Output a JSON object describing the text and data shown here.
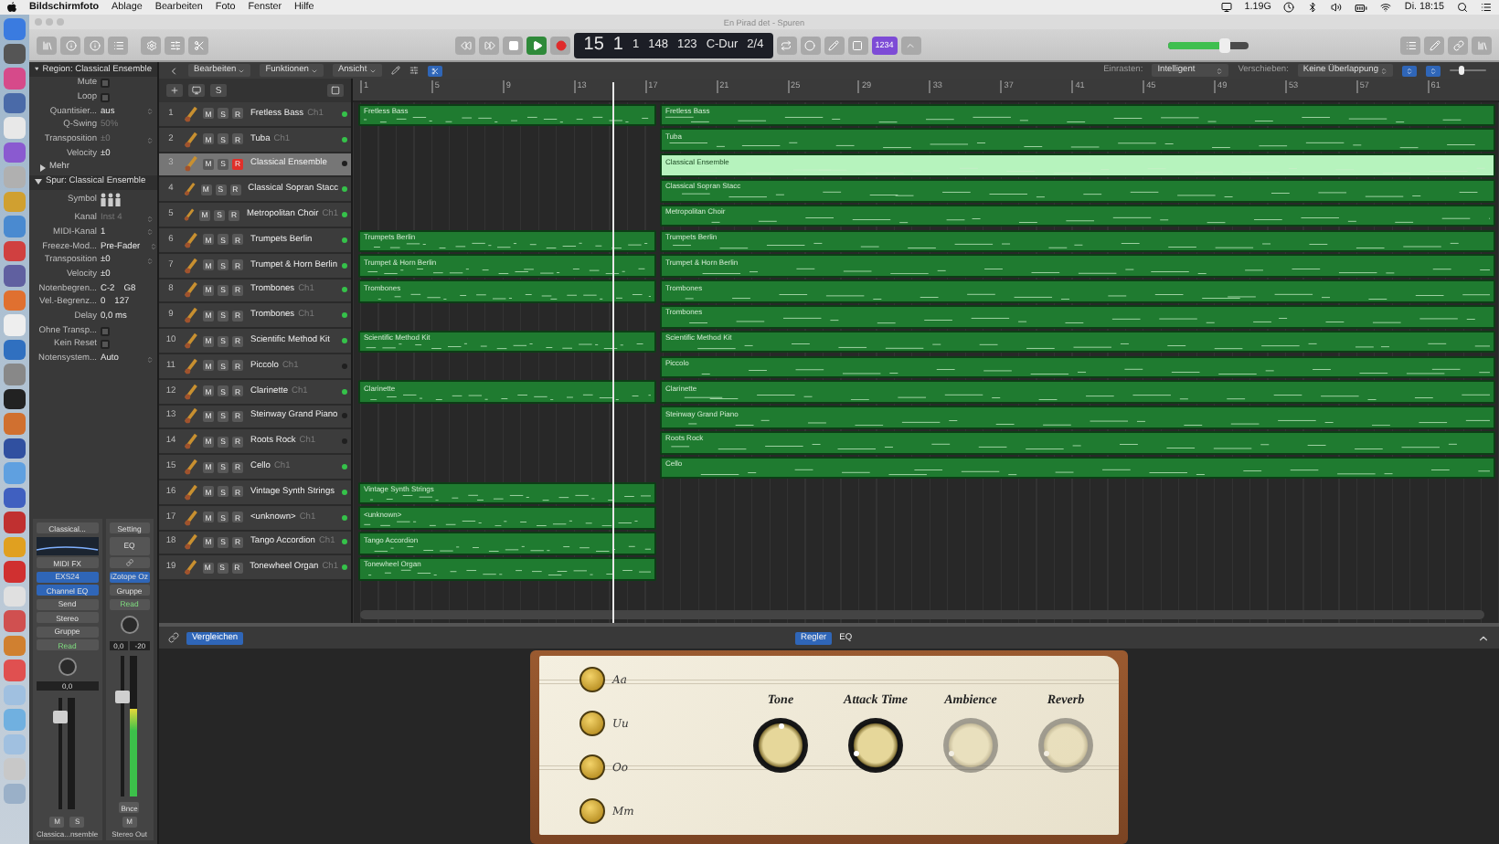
{
  "menu_bar": {
    "app": "Bildschirmfoto",
    "items": [
      "Ablage",
      "Bearbeiten",
      "Foto",
      "Fenster",
      "Hilfe"
    ],
    "memory": "1.19G",
    "clock": "Di. 18:15"
  },
  "window": {
    "title": "En Pirad det - Spuren"
  },
  "transport": {
    "playing": true
  },
  "lcd": [
    "15",
    "1",
    "1",
    "148",
    "123",
    "C-Dur",
    "2/4"
  ],
  "count_in": {
    "label": "1234",
    "on": true
  },
  "master_volume": {
    "level": 0.7
  },
  "arrange_toolbar": {
    "menus": [
      "Bearbeiten",
      "Funktionen",
      "Ansicht"
    ],
    "zoom": {
      "level": 0.3
    },
    "snap_label": "Einrasten:",
    "snap": "Intelligent",
    "drag_label": "Verschieben:",
    "drag": "Keine Überlappung"
  },
  "inspector": {
    "region": {
      "title": "Region: Classical Ensemble",
      "rows": [
        {
          "label": "Mute",
          "kind": "check",
          "checked": false
        },
        {
          "label": "Loop",
          "kind": "check",
          "checked": false
        },
        {
          "label": "Quantisier...",
          "kind": "select",
          "values": [
            "aus"
          ],
          "dim": false
        },
        {
          "label": "Q-Swing",
          "kind": "text",
          "values": [
            "50%"
          ],
          "dim": true
        },
        {
          "label": "Transposition",
          "kind": "select",
          "values": [
            "±0"
          ],
          "dim": true
        },
        {
          "label": "Velocity",
          "kind": "text",
          "values": [
            "±0"
          ],
          "dim": false
        }
      ],
      "more": "Mehr"
    },
    "track": {
      "title": "Spur: Classical Ensemble",
      "rows": [
        {
          "label": "Symbol",
          "kind": "icon"
        },
        {
          "label": "Kanal",
          "kind": "select",
          "values": [
            "Inst 4"
          ],
          "dim": true
        },
        {
          "label": "MIDI-Kanal",
          "kind": "select",
          "values": [
            "1"
          ],
          "dim": false
        },
        {
          "label": "Freeze-Mod...",
          "kind": "select",
          "values": [
            "Pre-Fader"
          ],
          "dim": false
        },
        {
          "label": "Transposition",
          "kind": "select",
          "values": [
            "±0"
          ],
          "dim": false
        },
        {
          "label": "Velocity",
          "kind": "text",
          "values": [
            "±0"
          ],
          "dim": false
        },
        {
          "label": "Notenbegren...",
          "kind": "text",
          "values": [
            "C-2",
            "G8"
          ],
          "dim": false
        },
        {
          "label": "Vel.-Begrenz...",
          "kind": "text",
          "values": [
            "0",
            "127"
          ],
          "dim": false
        },
        {
          "label": "Delay",
          "kind": "text",
          "values": [
            "0,0 ms"
          ],
          "dim": false
        },
        {
          "label": "Ohne Transp...",
          "kind": "check",
          "checked": false
        },
        {
          "label": "Kein Reset",
          "kind": "check",
          "checked": false
        },
        {
          "label": "Notensystem...",
          "kind": "select",
          "values": [
            "Auto"
          ],
          "dim": false
        }
      ]
    }
  },
  "channel_strips": [
    {
      "setting": "Classical...",
      "midi_fx": "MIDI FX",
      "inserts": [
        "EXS24",
        "Channel EQ"
      ],
      "send": "Send",
      "output": "Stereo",
      "group": "Gruppe",
      "automation": "Read",
      "readouts": [
        "0,0"
      ],
      "fader": {
        "level": 0.82
      },
      "meter": {
        "level": 0
      },
      "buttons": [
        "M",
        "S"
      ],
      "name": "Classica...nsemble"
    },
    {
      "setting": "Setting",
      "eq": "EQ",
      "inserts": [
        "iZotope Oz"
      ],
      "group": "Gruppe",
      "automation": "Read",
      "readouts": [
        "0,0",
        "-20"
      ],
      "fader": {
        "level": 0.7
      },
      "meter": {
        "level": 0.62
      },
      "bounce": "Bnce",
      "buttons": [
        "M"
      ],
      "name": "Stereo Out"
    }
  ],
  "track_list_header": {
    "solo": "S"
  },
  "ruler": [
    "1",
    "5",
    "9",
    "13",
    "17",
    "21",
    "25",
    "29",
    "33",
    "37",
    "41",
    "45",
    "49",
    "53",
    "57",
    "61"
  ],
  "playhead": {
    "level": 0.227
  },
  "tracks": [
    {
      "number": "1",
      "name": "Fretless Bass",
      "channel": "Ch1",
      "buttons": [
        "M",
        "S",
        "R"
      ],
      "record": false,
      "selected": false,
      "active": true,
      "regions": [
        {
          "name": "Fretless Bass",
          "kind": "first",
          "selected": false
        },
        {
          "name": "Fretless Bass",
          "kind": "second",
          "selected": false
        }
      ]
    },
    {
      "number": "2",
      "name": "Tuba",
      "channel": "Ch1",
      "buttons": [
        "M",
        "S",
        "R"
      ],
      "record": false,
      "selected": false,
      "active": true,
      "regions": [
        {
          "name": "Tuba",
          "kind": "second",
          "selected": false
        }
      ]
    },
    {
      "number": "3",
      "name": "Classical Ensemble",
      "buttons": [
        "M",
        "S",
        "R"
      ],
      "record": true,
      "selected": true,
      "active": false,
      "regions": [
        {
          "name": "Classical Ensemble",
          "kind": "second",
          "selected": true
        }
      ]
    },
    {
      "number": "4",
      "name": "Classical Sopran Stacc",
      "buttons": [
        "M",
        "S",
        "R"
      ],
      "record": false,
      "selected": false,
      "active": true,
      "regions": [
        {
          "name": "Classical Sopran Stacc",
          "kind": "second",
          "selected": false
        }
      ]
    },
    {
      "number": "5",
      "name": "Metropolitan Choir",
      "channel": "Ch1",
      "buttons": [
        "M",
        "S",
        "R"
      ],
      "record": false,
      "selected": false,
      "active": true,
      "regions": [
        {
          "name": "Metropolitan Choir",
          "kind": "second",
          "selected": false
        }
      ]
    },
    {
      "number": "6",
      "name": "Trumpets Berlin",
      "buttons": [
        "M",
        "S",
        "R"
      ],
      "record": false,
      "selected": false,
      "active": true,
      "regions": [
        {
          "name": "Trumpets Berlin",
          "kind": "first",
          "selected": false
        },
        {
          "name": "Trumpets Berlin",
          "kind": "second",
          "selected": false
        }
      ]
    },
    {
      "number": "7",
      "name": "Trumpet & Horn Berlin",
      "buttons": [
        "M",
        "S",
        "R"
      ],
      "record": false,
      "selected": false,
      "active": true,
      "regions": [
        {
          "name": "Trumpet & Horn Berlin",
          "kind": "first",
          "selected": false
        },
        {
          "name": "Trumpet & Horn Berlin",
          "kind": "second",
          "selected": false
        }
      ]
    },
    {
      "number": "8",
      "name": "Trombones",
      "channel": "Ch1",
      "buttons": [
        "M",
        "S",
        "R"
      ],
      "record": false,
      "selected": false,
      "active": true,
      "regions": [
        {
          "name": "Trombones",
          "kind": "first",
          "selected": false
        },
        {
          "name": "Trombones",
          "kind": "second",
          "selected": false
        }
      ]
    },
    {
      "number": "9",
      "name": "Trombones",
      "channel": "Ch1",
      "buttons": [
        "M",
        "S",
        "R"
      ],
      "record": false,
      "selected": false,
      "active": true,
      "regions": [
        {
          "name": "Trombones",
          "kind": "second",
          "selected": false
        }
      ]
    },
    {
      "number": "10",
      "name": "Scientific Method Kit",
      "buttons": [
        "M",
        "S",
        "R"
      ],
      "record": false,
      "selected": false,
      "active": true,
      "regions": [
        {
          "name": "Scientific Method Kit",
          "kind": "first",
          "selected": false
        },
        {
          "name": "Scientific Method Kit",
          "kind": "second",
          "selected": false
        }
      ]
    },
    {
      "number": "11",
      "name": "Piccolo",
      "channel": "Ch1",
      "buttons": [
        "M",
        "S",
        "R"
      ],
      "record": false,
      "selected": false,
      "active": false,
      "regions": [
        {
          "name": "Piccolo",
          "kind": "second",
          "selected": false
        }
      ]
    },
    {
      "number": "12",
      "name": "Clarinette",
      "channel": "Ch1",
      "buttons": [
        "M",
        "S",
        "R"
      ],
      "record": false,
      "selected": false,
      "active": true,
      "regions": [
        {
          "name": "Clarinette",
          "kind": "first",
          "selected": false
        },
        {
          "name": "Clarinette",
          "kind": "second",
          "selected": false
        }
      ]
    },
    {
      "number": "13",
      "name": "Steinway Grand Piano",
      "buttons": [
        "M",
        "S",
        "R"
      ],
      "record": false,
      "selected": false,
      "active": false,
      "regions": [
        {
          "name": "Steinway Grand Piano",
          "kind": "second",
          "selected": false
        }
      ]
    },
    {
      "number": "14",
      "name": "Roots Rock",
      "channel": "Ch1",
      "buttons": [
        "M",
        "S",
        "R"
      ],
      "record": false,
      "selected": false,
      "active": false,
      "regions": [
        {
          "name": "Roots Rock",
          "kind": "second",
          "selected": false
        }
      ]
    },
    {
      "number": "15",
      "name": "Cello",
      "channel": "Ch1",
      "buttons": [
        "M",
        "S",
        "R"
      ],
      "record": false,
      "selected": false,
      "active": true,
      "regions": [
        {
          "name": "Cello",
          "kind": "second",
          "selected": false
        }
      ]
    },
    {
      "number": "16",
      "name": "Vintage Synth Strings",
      "buttons": [
        "M",
        "S",
        "R"
      ],
      "record": false,
      "selected": false,
      "active": true,
      "regions": [
        {
          "name": "Vintage Synth Strings",
          "kind": "first",
          "selected": false
        }
      ]
    },
    {
      "number": "17",
      "name": "<unknown>",
      "channel": "Ch1",
      "buttons": [
        "M",
        "S",
        "R"
      ],
      "record": false,
      "selected": false,
      "active": true,
      "regions": [
        {
          "name": "<unknown>",
          "kind": "first",
          "selected": false
        }
      ]
    },
    {
      "number": "18",
      "name": "Tango Accordion",
      "channel": "Ch1",
      "buttons": [
        "M",
        "S",
        "R"
      ],
      "record": false,
      "selected": false,
      "active": true,
      "regions": [
        {
          "name": "Tango Accordion",
          "kind": "first",
          "selected": false
        }
      ]
    },
    {
      "number": "19",
      "name": "Tonewheel Organ",
      "channel": "Ch1",
      "buttons": [
        "M",
        "S",
        "R"
      ],
      "record": false,
      "selected": false,
      "active": true,
      "regions": [
        {
          "name": "Tonewheel Organ",
          "kind": "first",
          "selected": false
        }
      ]
    }
  ],
  "bottom_pane": {
    "compare": "Vergleichen",
    "tabs": [
      {
        "label": "Regler",
        "selected": true
      },
      {
        "label": "EQ",
        "selected": false
      }
    ]
  },
  "plugin": {
    "articulations": [
      "Aa",
      "Uu",
      "Oo",
      "Mm"
    ],
    "knobs": [
      {
        "label": "Tone",
        "level": 0.5,
        "disabled": false
      },
      {
        "label": "Attack Time",
        "level": 0.08,
        "disabled": false
      },
      {
        "label": "Ambience",
        "level": 0.08,
        "disabled": true
      },
      {
        "label": "Reverb",
        "level": 0.08,
        "disabled": true
      }
    ]
  }
}
